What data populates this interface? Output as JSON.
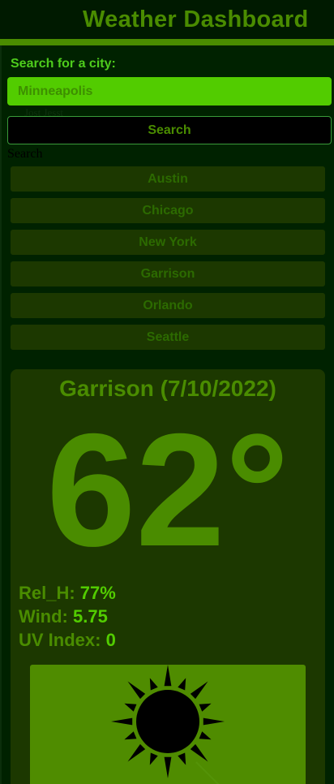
{
  "header": {
    "title": "Weather Dashboard"
  },
  "search": {
    "label": "Search for a city:",
    "value": "Minneapolis",
    "placeholder": "Minneapolis",
    "button_label": "Search",
    "ghost_text_1": "Jost Jesst",
    "ghost_text_2": "Search"
  },
  "history": {
    "cities": [
      "Austin",
      "Chicago",
      "New York",
      "Garrison",
      "Orlando",
      "Seattle"
    ]
  },
  "current": {
    "title": "Garrison (7/10/2022)",
    "temperature": "62°",
    "humidity_label": "Rel_H: ",
    "humidity_value": "77%",
    "wind_label": "Wind: ",
    "wind_value": "5.75",
    "uv_label": "UV Index: ",
    "uv_value": "0",
    "icon": "sun-icon"
  },
  "colors": {
    "background": "#002200",
    "accent": "#4a8c00",
    "bright": "#52cc00",
    "card": "#1c3800"
  }
}
